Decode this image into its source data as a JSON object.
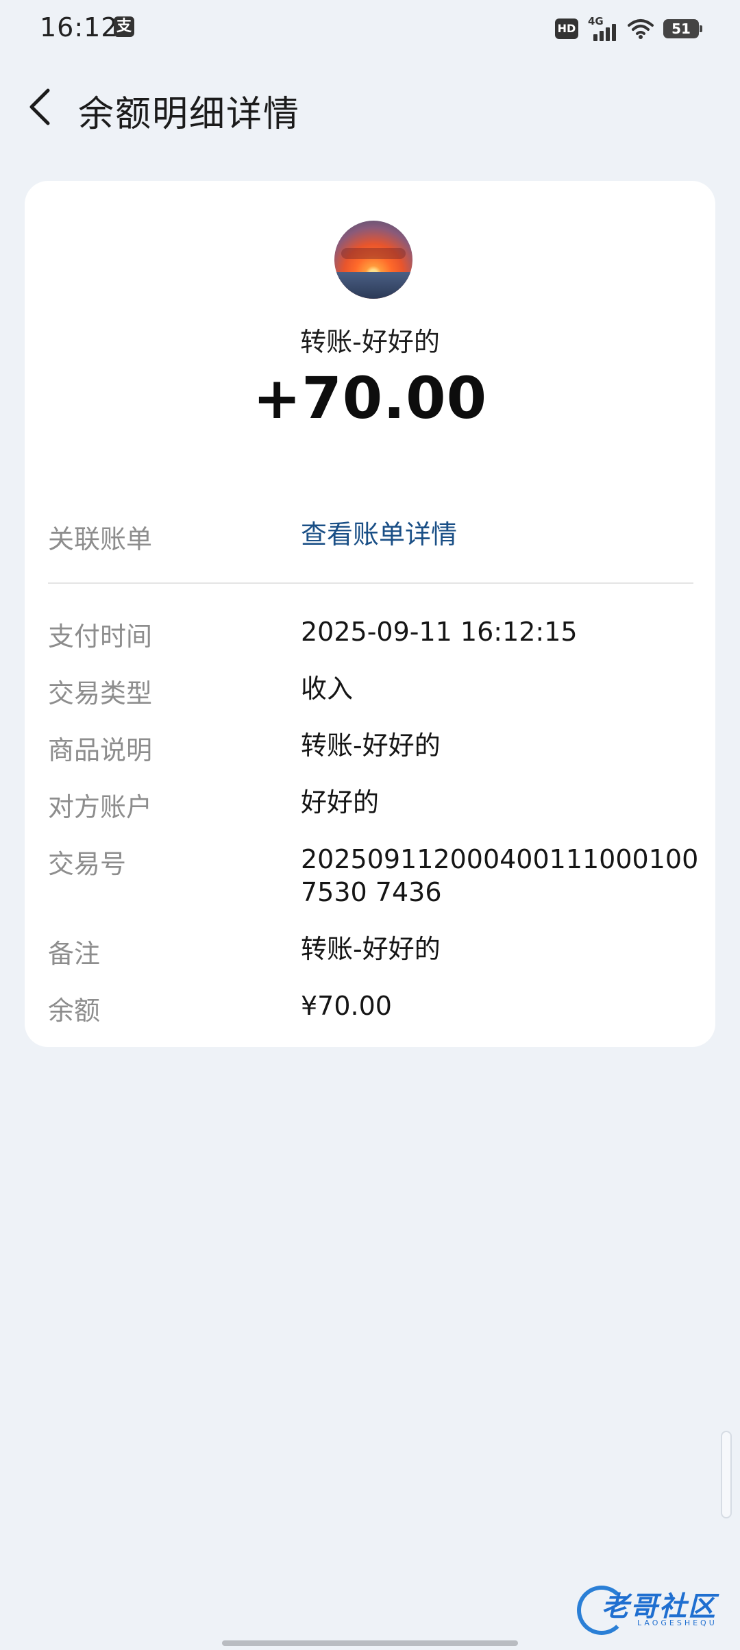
{
  "status_bar": {
    "time": "16:12",
    "alipay_badge": "支",
    "hd_badge": "HD",
    "network": "4G",
    "battery": "51"
  },
  "header": {
    "title": "余额明细详情",
    "back_icon": "chevron-left-icon"
  },
  "summary": {
    "counterparty_title": "转账-好好的",
    "amount": "+70.00"
  },
  "linked_bill": {
    "label": "关联账单",
    "value": "查看账单详情"
  },
  "details": [
    {
      "label": "支付时间",
      "value": "2025-09-11 16:12:15"
    },
    {
      "label": "交易类型",
      "value": "收入"
    },
    {
      "label": "商品说明",
      "value": "转账-好好的"
    },
    {
      "label": "对方账户",
      "value": "好好的"
    },
    {
      "label": "交易号",
      "value": "2025091120004001110001007530 7436"
    },
    {
      "label": "备注",
      "value": "转账-好好的"
    },
    {
      "label": "余额",
      "value": "¥70.00"
    }
  ],
  "watermark": {
    "text": "老哥社区",
    "sub": "LAOGESHEQU"
  },
  "colors": {
    "background": "#eef2f7",
    "card": "#ffffff",
    "link": "#1a4f86",
    "label": "#8d8d8d"
  }
}
